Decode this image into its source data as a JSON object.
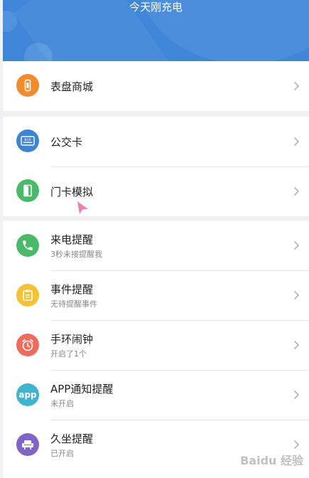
{
  "header": {
    "title": "今天刚充电"
  },
  "menu": {
    "watch_faces": {
      "title": "表盘商城"
    },
    "bus_card": {
      "title": "公交卡",
      "icon_text": "BUS"
    },
    "door_card": {
      "title": "门卡模拟"
    },
    "call_reminder": {
      "title": "来电提醒",
      "subtitle": "3秒未接提醒我"
    },
    "event_reminder": {
      "title": "事件提醒",
      "subtitle": "无待提醒事件"
    },
    "band_alarm": {
      "title": "手环闹钟",
      "subtitle": "开启了1个"
    },
    "app_notify": {
      "title": "APP通知提醒",
      "subtitle": "未开启",
      "icon_text": "app"
    },
    "sedentary": {
      "title": "久坐提醒",
      "subtitle": "已开启"
    }
  },
  "watermark": {
    "text": "Baidu 经验"
  },
  "colors": {
    "header_bg": "#3f86d9",
    "orange": "#f08c2e",
    "blue": "#3d83d6",
    "green": "#4aba6a",
    "yellow": "#f4c234",
    "red": "#ef6b5c",
    "teal": "#3fb3d0",
    "purple": "#7e65c7",
    "cursor": "#f07fb0"
  },
  "icons": {
    "watch_faces": "watch-icon",
    "bus_card": "bus-card-icon",
    "door_card": "door-icon",
    "call_reminder": "phone-icon",
    "event_reminder": "clipboard-icon",
    "band_alarm": "alarm-clock-icon",
    "app_notify": "app-icon",
    "sedentary": "seat-icon"
  }
}
